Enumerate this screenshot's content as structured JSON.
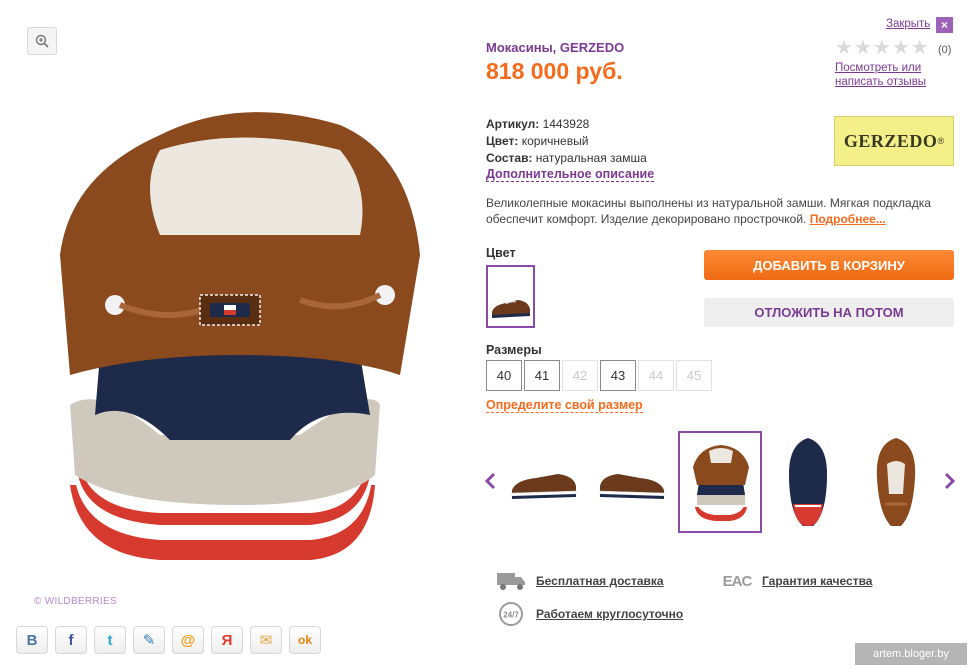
{
  "product": {
    "title": "Мокасины, GERZEDO",
    "price": "818 000 руб.",
    "article_label": "Артикул:",
    "article_value": "1443928",
    "color_label": "Цвет:",
    "color_value": "коричневый",
    "material_label": "Состав:",
    "material_value": "натуральная замша",
    "more_description_link": "Дополнительное описание",
    "description": "Великолепные мокасины выполнены из натуральной замши. Мягкая подкладка обеспечит комфорт. Изделие декорировано прострочкой.",
    "more_link": "Подробнее...",
    "brand_logo_text": "GERZEDO"
  },
  "header": {
    "close_label": "Закрыть",
    "close_icon": "×"
  },
  "rating": {
    "stars": [
      "★",
      "★",
      "★",
      "★",
      "★"
    ],
    "stars_filled": 0,
    "count": "(0)",
    "reviews_link": "Посмотреть или написать отзывы"
  },
  "color_section": {
    "label": "Цвет"
  },
  "actions": {
    "add_to_cart": "ДОБАВИТЬ В КОРЗИНУ",
    "save_for_later": "ОТЛОЖИТЬ НА ПОТОМ"
  },
  "sizes": {
    "label": "Размеры",
    "options": [
      {
        "value": "40",
        "available": true
      },
      {
        "value": "41",
        "available": true
      },
      {
        "value": "42",
        "available": false
      },
      {
        "value": "43",
        "available": true
      },
      {
        "value": "44",
        "available": false
      },
      {
        "value": "45",
        "available": false
      }
    ],
    "help_link": "Определите свой размер"
  },
  "gallery": {
    "prev_arrow": "‹",
    "next_arrow": "›",
    "active_index": 2,
    "thumb_count": 5
  },
  "features": {
    "delivery": "Бесплатная доставка",
    "quality": "Гарантия качества",
    "support": "Работаем круглосуточно",
    "eac_icon_text": "EAC",
    "support_icon_text": "24/7"
  },
  "watermark": "© WILDBERRIES",
  "social": {
    "vk": "B",
    "fb": "f",
    "twitter": "t",
    "livejournal": "✎",
    "mail": "@",
    "yandex": "Я",
    "email": "✉",
    "ok": "ok"
  },
  "blog_tag": "artem.bloger.by",
  "colors": {
    "accent_purple": "#7b3a92",
    "accent_orange": "#f46b1d"
  }
}
